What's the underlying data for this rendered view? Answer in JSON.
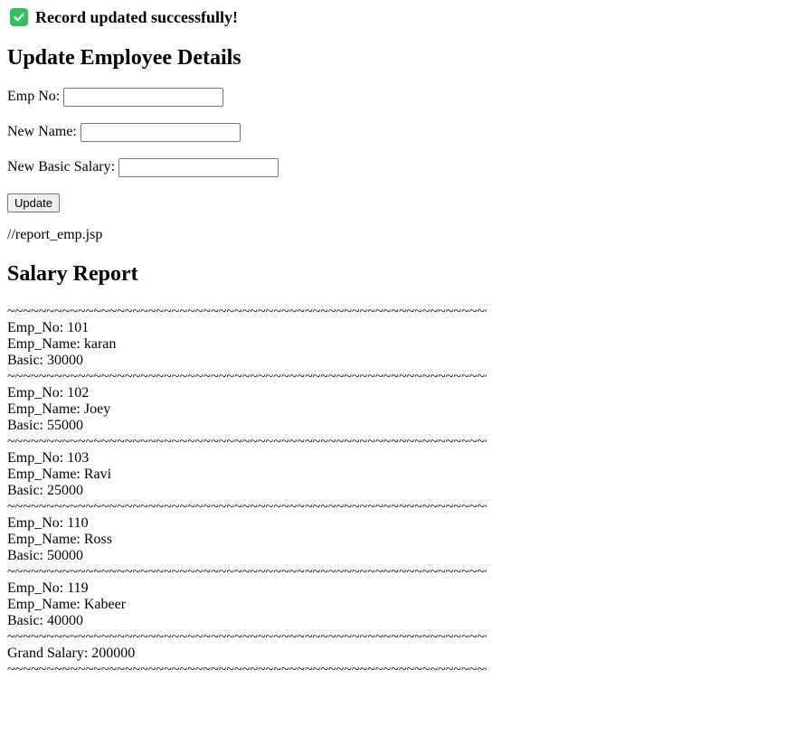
{
  "status": {
    "message": "Record updated successfully!",
    "icon": "check-icon",
    "color": "#2fc35b"
  },
  "form": {
    "title": "Update Employee Details",
    "empno_label": "Emp No:",
    "empno_value": "",
    "name_label": "New Name:",
    "name_value": "",
    "salary_label": "New Basic Salary:",
    "salary_value": "",
    "submit_label": "Update"
  },
  "comment": "//report_emp.jsp",
  "report": {
    "title": "Salary Report",
    "separator": "~~~~~~~~~~~~~~~~~~~~~~~~~~~~~~~~~~~~~~~~~~~~~~~~~~~~~~~~~~~~~~~~~~~~~~~~~~~~~~~~~~~~~~~~~~~~~~~~~~~~~~~~~~~~~~~~~~~~",
    "employees": [
      {
        "no": "Emp_No: 101",
        "name": "Emp_Name: karan",
        "basic": "Basic: 30000"
      },
      {
        "no": "Emp_No: 102",
        "name": "Emp_Name: Joey",
        "basic": "Basic: 55000"
      },
      {
        "no": "Emp_No: 103",
        "name": "Emp_Name: Ravi",
        "basic": "Basic: 25000"
      },
      {
        "no": "Emp_No: 110",
        "name": "Emp_Name: Ross",
        "basic": "Basic: 50000"
      },
      {
        "no": "Emp_No: 119",
        "name": "Emp_Name: Kabeer",
        "basic": "Basic: 40000"
      }
    ],
    "grand_total": "Grand Salary: 200000"
  }
}
